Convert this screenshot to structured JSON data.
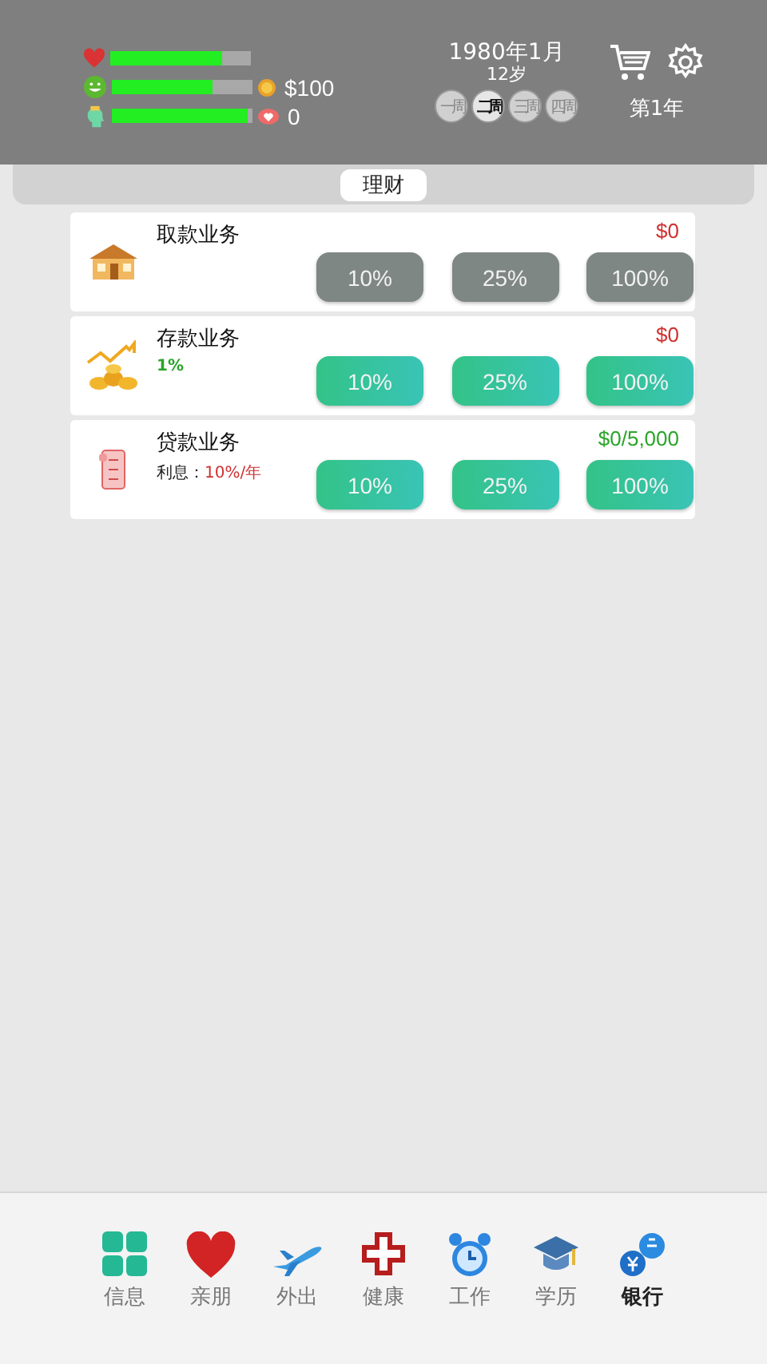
{
  "status": {
    "stats": [
      {
        "kind": "health",
        "level": 0.8
      },
      {
        "kind": "mood",
        "level": 0.72,
        "reading": {
          "kind": "coin",
          "text": "$100"
        }
      },
      {
        "kind": "mind",
        "level": 0.97,
        "reading": {
          "kind": "heart",
          "text": "0"
        }
      }
    ],
    "date": "1980年1月",
    "age": "12岁",
    "weeks": [
      {
        "label": "一周",
        "selected": false
      },
      {
        "label": "二周",
        "selected": true
      },
      {
        "label": "三周",
        "selected": false
      },
      {
        "label": "四周",
        "selected": false
      }
    ],
    "year": "第1年"
  },
  "tabs": [
    {
      "label": "理财",
      "selected": true
    }
  ],
  "services": [
    {
      "kind": "withdraw",
      "title": "取款业务",
      "amount": "$0",
      "color": "#d03030",
      "disabled": true,
      "buttons": [
        "10%",
        "25%",
        "100%"
      ]
    },
    {
      "kind": "deposit",
      "title": "存款业务",
      "rate": "1%",
      "amount": "$0",
      "color": "#d03030",
      "disabled": false,
      "buttons": [
        "10%",
        "25%",
        "100%"
      ]
    },
    {
      "kind": "loan",
      "title": "贷款业务",
      "interest_label": "利息：",
      "interest": "10%/年",
      "amount": "$0/5,000",
      "color": "#2aa52a",
      "disabled": false,
      "buttons": [
        "10%",
        "25%",
        "100%"
      ]
    }
  ],
  "nav": [
    {
      "kind": "info",
      "label": "信息",
      "selected": false
    },
    {
      "kind": "family",
      "label": "亲朋",
      "selected": false
    },
    {
      "kind": "travel",
      "label": "外出",
      "selected": false
    },
    {
      "kind": "health",
      "label": "健康",
      "selected": false
    },
    {
      "kind": "work",
      "label": "工作",
      "selected": false
    },
    {
      "kind": "education",
      "label": "学历",
      "selected": false
    },
    {
      "kind": "bank",
      "label": "银行",
      "selected": true
    }
  ]
}
